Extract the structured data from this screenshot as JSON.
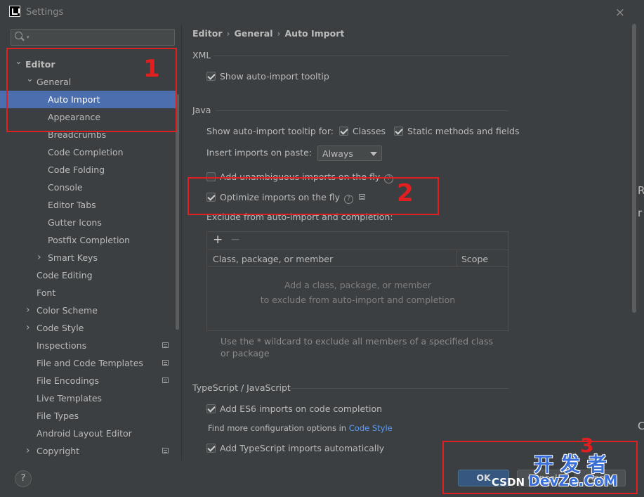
{
  "window": {
    "title": "Settings",
    "close": "×"
  },
  "search": {
    "placeholder": "",
    "caret": "▾"
  },
  "tree": [
    {
      "label": "Editor",
      "depth": 0,
      "expanded": true,
      "bold": true
    },
    {
      "label": "General",
      "depth": 1,
      "expanded": true
    },
    {
      "label": "Auto Import",
      "depth": 2,
      "selected": true
    },
    {
      "label": "Appearance",
      "depth": 2
    },
    {
      "label": "Breadcrumbs",
      "depth": 2
    },
    {
      "label": "Code Completion",
      "depth": 2
    },
    {
      "label": "Code Folding",
      "depth": 2
    },
    {
      "label": "Console",
      "depth": 2
    },
    {
      "label": "Editor Tabs",
      "depth": 2
    },
    {
      "label": "Gutter Icons",
      "depth": 2
    },
    {
      "label": "Postfix Completion",
      "depth": 2
    },
    {
      "label": "Smart Keys",
      "depth": 2,
      "collapsed": true
    },
    {
      "label": "Code Editing",
      "depth": 1
    },
    {
      "label": "Font",
      "depth": 1
    },
    {
      "label": "Color Scheme",
      "depth": 1,
      "collapsed": true
    },
    {
      "label": "Code Style",
      "depth": 1,
      "collapsed": true
    },
    {
      "label": "Inspections",
      "depth": 1,
      "icon": true
    },
    {
      "label": "File and Code Templates",
      "depth": 1,
      "icon": true
    },
    {
      "label": "File Encodings",
      "depth": 1,
      "icon": true
    },
    {
      "label": "Live Templates",
      "depth": 1
    },
    {
      "label": "File Types",
      "depth": 1
    },
    {
      "label": "Android Layout Editor",
      "depth": 1
    },
    {
      "label": "Copyright",
      "depth": 1,
      "collapsed": true,
      "icon": true
    }
  ],
  "breadcrumb": [
    "Editor",
    "General",
    "Auto Import"
  ],
  "xml": {
    "section": "XML",
    "show_tooltip": {
      "label": "Show auto-import tooltip",
      "checked": true
    }
  },
  "java": {
    "section": "Java",
    "show_tooltip_for_label": "Show auto-import tooltip for:",
    "classes": {
      "label": "Classes",
      "checked": true
    },
    "static_methods": {
      "label": "Static methods and fields",
      "checked": true
    },
    "insert_on_paste_label": "Insert imports on paste:",
    "insert_on_paste_value": "Always",
    "add_unambiguous": {
      "label": "Add unambiguous imports on the fly",
      "checked": false
    },
    "optimize": {
      "label": "Optimize imports on the fly",
      "checked": true
    },
    "exclude_label": "Exclude from auto-import and completion:",
    "table_headers": [
      "Class, package, or member",
      "Scope"
    ],
    "empty_line1": "Add a class, package, or member",
    "empty_line2": "to exclude from auto-import and completion",
    "hint": "Use the * wildcard to exclude all members of a specified class or package"
  },
  "ts": {
    "section": "TypeScript / JavaScript",
    "es6": {
      "label": "Add ES6 imports on code completion",
      "checked": true
    },
    "more_prefix": "Find more configuration options in",
    "more_link": "Code Style",
    "ts_auto": {
      "label": "Add TypeScript imports automatically",
      "checked": true
    }
  },
  "buttons": {
    "help": "?",
    "ok": "OK",
    "cancel": "Cancel",
    "apply": "Apply"
  },
  "toolbar": {
    "add": "+",
    "remove": "−"
  },
  "annotations": [
    "1",
    "2",
    "3"
  ],
  "watermark": {
    "cn": "开发者",
    "csdn": "CSDN",
    "site": "DevZe.CoM"
  },
  "peek": [
    "R",
    "r",
    "C"
  ],
  "colors": {
    "accent": "#4b6eaf",
    "annotation": "#e02020",
    "link": "#589df6"
  }
}
